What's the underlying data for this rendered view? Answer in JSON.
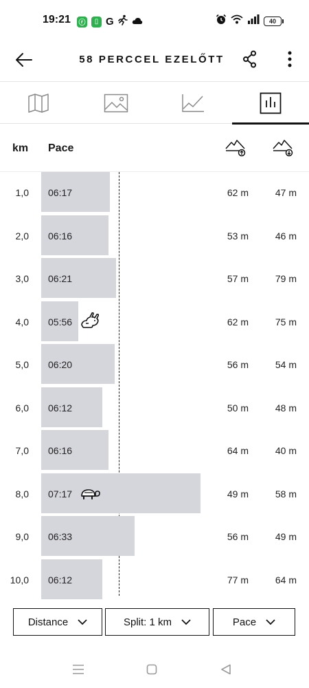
{
  "status": {
    "time": "19:21",
    "app_badge_1": "ⓡ",
    "app_badge_2": "▯",
    "g_letter": "G",
    "battery": "40"
  },
  "header": {
    "title": "58 PERCCEL EZELŐTT"
  },
  "tabs": [
    {
      "icon": "map-icon",
      "active": false
    },
    {
      "icon": "image-icon",
      "active": false
    },
    {
      "icon": "line-chart-icon",
      "active": false
    },
    {
      "icon": "bar-chart-icon",
      "active": true
    }
  ],
  "columns": {
    "km": "km",
    "pace": "Pace",
    "elevation_up_icon": "elevation-gain-icon",
    "elevation_down_icon": "elevation-loss-icon"
  },
  "splits": [
    {
      "km": "1,0",
      "pace": "06:17",
      "pace_seconds": 377,
      "up": "62 m",
      "down": "47 m",
      "marker": ""
    },
    {
      "km": "2,0",
      "pace": "06:16",
      "pace_seconds": 376,
      "up": "53 m",
      "down": "46 m",
      "marker": ""
    },
    {
      "km": "3,0",
      "pace": "06:21",
      "pace_seconds": 381,
      "up": "57 m",
      "down": "79 m",
      "marker": ""
    },
    {
      "km": "4,0",
      "pace": "05:56",
      "pace_seconds": 356,
      "up": "62 m",
      "down": "75 m",
      "marker": "fastest"
    },
    {
      "km": "5,0",
      "pace": "06:20",
      "pace_seconds": 380,
      "up": "56 m",
      "down": "54 m",
      "marker": ""
    },
    {
      "km": "6,0",
      "pace": "06:12",
      "pace_seconds": 372,
      "up": "50 m",
      "down": "48 m",
      "marker": ""
    },
    {
      "km": "7,0",
      "pace": "06:16",
      "pace_seconds": 376,
      "up": "64 m",
      "down": "40 m",
      "marker": ""
    },
    {
      "km": "8,0",
      "pace": "07:17",
      "pace_seconds": 437,
      "up": "49 m",
      "down": "58 m",
      "marker": "slowest"
    },
    {
      "km": "9,0",
      "pace": "06:33",
      "pace_seconds": 393,
      "up": "56 m",
      "down": "49 m",
      "marker": ""
    },
    {
      "km": "10,0",
      "pace": "06:12",
      "pace_seconds": 372,
      "up": "77 m",
      "down": "64 m",
      "marker": ""
    }
  ],
  "selectors": {
    "distance": "Distance",
    "split": "Split: 1 km",
    "metric": "Pace"
  },
  "colors": {
    "bar": "#d5d6dc",
    "text": "#1a1a1a"
  }
}
